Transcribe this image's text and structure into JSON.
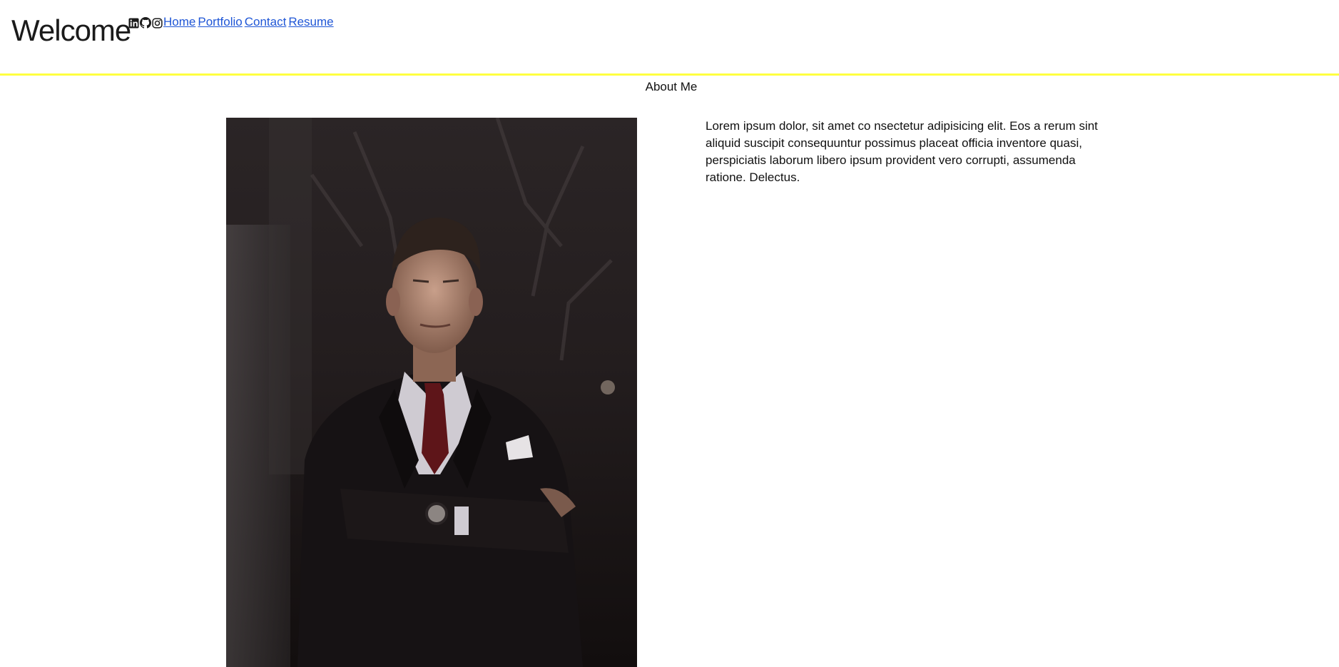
{
  "header": {
    "title": "Welcome",
    "social_icons": [
      "linkedin-icon",
      "github-icon",
      "instagram-icon"
    ],
    "nav": [
      {
        "label": "Home"
      },
      {
        "label": "Portfolio"
      },
      {
        "label": "Contact"
      },
      {
        "label": "Resume"
      }
    ],
    "accent_color": "#ffff40",
    "link_color": "#1f56d6"
  },
  "about": {
    "title": "About Me",
    "body": "Lorem ipsum dolor, sit amet co nsectetur adipisicing elit. Eos a rerum sint aliquid suscipit consequuntur possimus placeat officia inventore quasi, perspiciatis laborum libero ipsum provident vero corrupti, assumenda ratione. Delectus."
  }
}
